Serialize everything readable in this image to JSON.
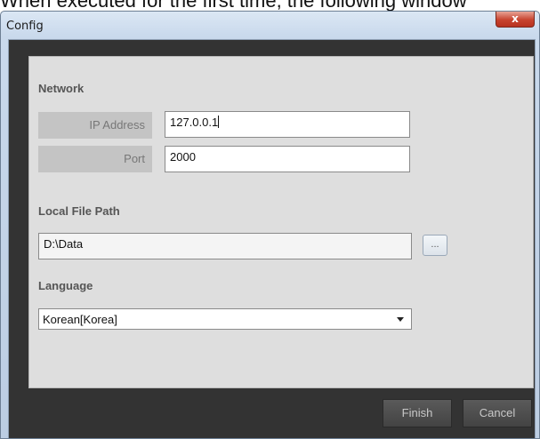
{
  "caption": "When executed for the first time, the following window",
  "window": {
    "title": "Config",
    "close_glyph": "x"
  },
  "network": {
    "heading": "Network",
    "ip_label": "IP Address",
    "ip_value": "127.0.0.1",
    "port_label": "Port",
    "port_value": "2000"
  },
  "local_file": {
    "heading": "Local File Path",
    "path_value": "D:\\Data",
    "browse_label": "..."
  },
  "language": {
    "heading": "Language",
    "selected": "Korean[Korea]"
  },
  "buttons": {
    "finish": "Finish",
    "cancel": "Cancel"
  }
}
